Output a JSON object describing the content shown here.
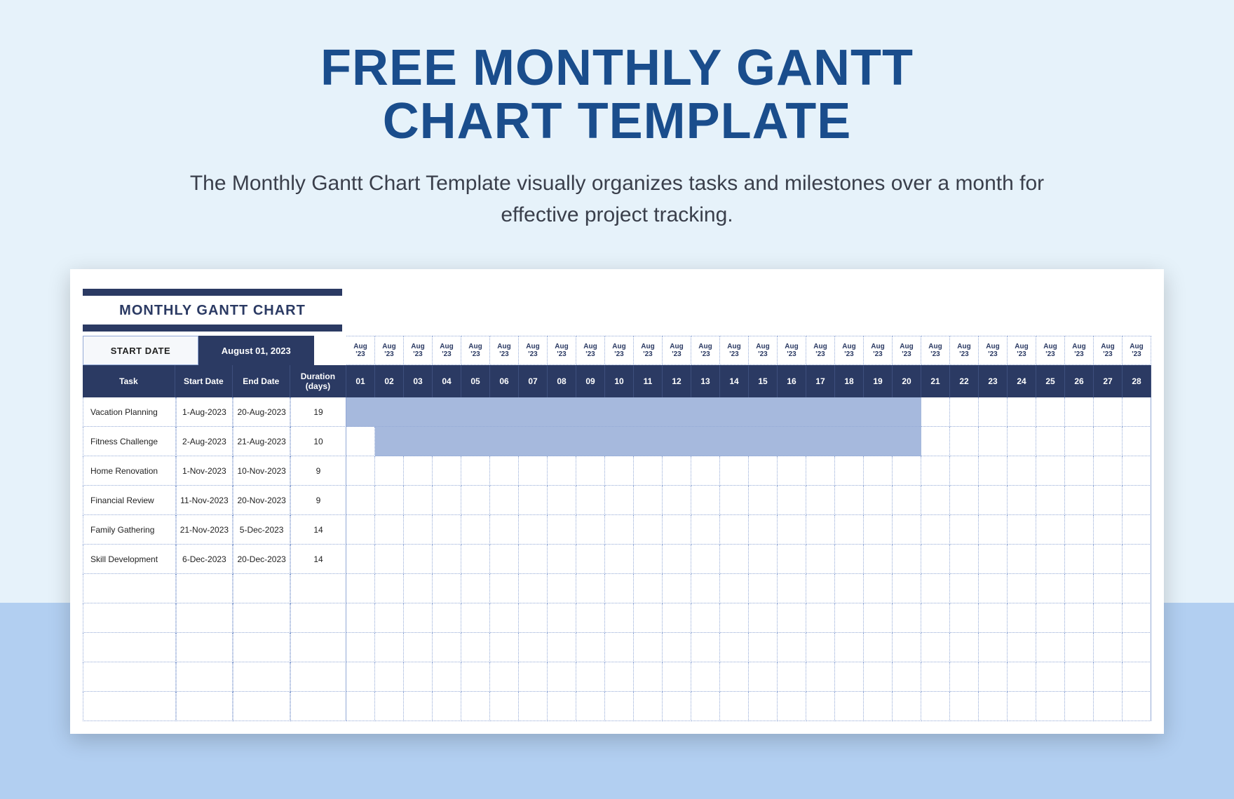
{
  "title_line1": "FREE MONTHLY GANTT",
  "title_line2": "CHART TEMPLATE",
  "subtitle": "The Monthly Gantt Chart Template visually organizes tasks and milestones over a month for effective project tracking.",
  "chart_title": "MONTHLY GANTT CHART",
  "start_date_label": "START DATE",
  "start_date_value": "August 01, 2023",
  "month_header": "Aug '23",
  "col_headers": {
    "task": "Task",
    "start": "Start Date",
    "end": "End Date",
    "duration": "Duration (days)"
  },
  "days": [
    "01",
    "02",
    "03",
    "04",
    "05",
    "06",
    "07",
    "08",
    "09",
    "10",
    "11",
    "12",
    "13",
    "14",
    "15",
    "16",
    "17",
    "18",
    "19",
    "20",
    "21",
    "22",
    "23",
    "24",
    "25",
    "26",
    "27",
    "28"
  ],
  "tasks": [
    {
      "name": "Vacation Planning",
      "start": "1-Aug-2023",
      "end": "20-Aug-2023",
      "duration": "19"
    },
    {
      "name": "Fitness Challenge",
      "start": "2-Aug-2023",
      "end": "21-Aug-2023",
      "duration": "10"
    },
    {
      "name": "Home Renovation",
      "start": "1-Nov-2023",
      "end": "10-Nov-2023",
      "duration": "9"
    },
    {
      "name": "Financial Review",
      "start": "11-Nov-2023",
      "end": "20-Nov-2023",
      "duration": "9"
    },
    {
      "name": "Family Gathering",
      "start": "21-Nov-2023",
      "end": "5-Dec-2023",
      "duration": "14"
    },
    {
      "name": "Skill Development",
      "start": "6-Dec-2023",
      "end": "20-Dec-2023",
      "duration": "14"
    }
  ],
  "empty_rows": 5,
  "chart_data": {
    "type": "gantt",
    "title": "MONTHLY GANTT CHART",
    "x_unit": "day_of_month_august_2023",
    "x_range": [
      1,
      28
    ],
    "bars_visible_in_august": [
      {
        "task": "Vacation Planning",
        "start_day": 1,
        "end_day": 20
      },
      {
        "task": "Fitness Challenge",
        "start_day": 2,
        "end_day": 20
      }
    ],
    "bar_color": "#a6b9dd"
  }
}
